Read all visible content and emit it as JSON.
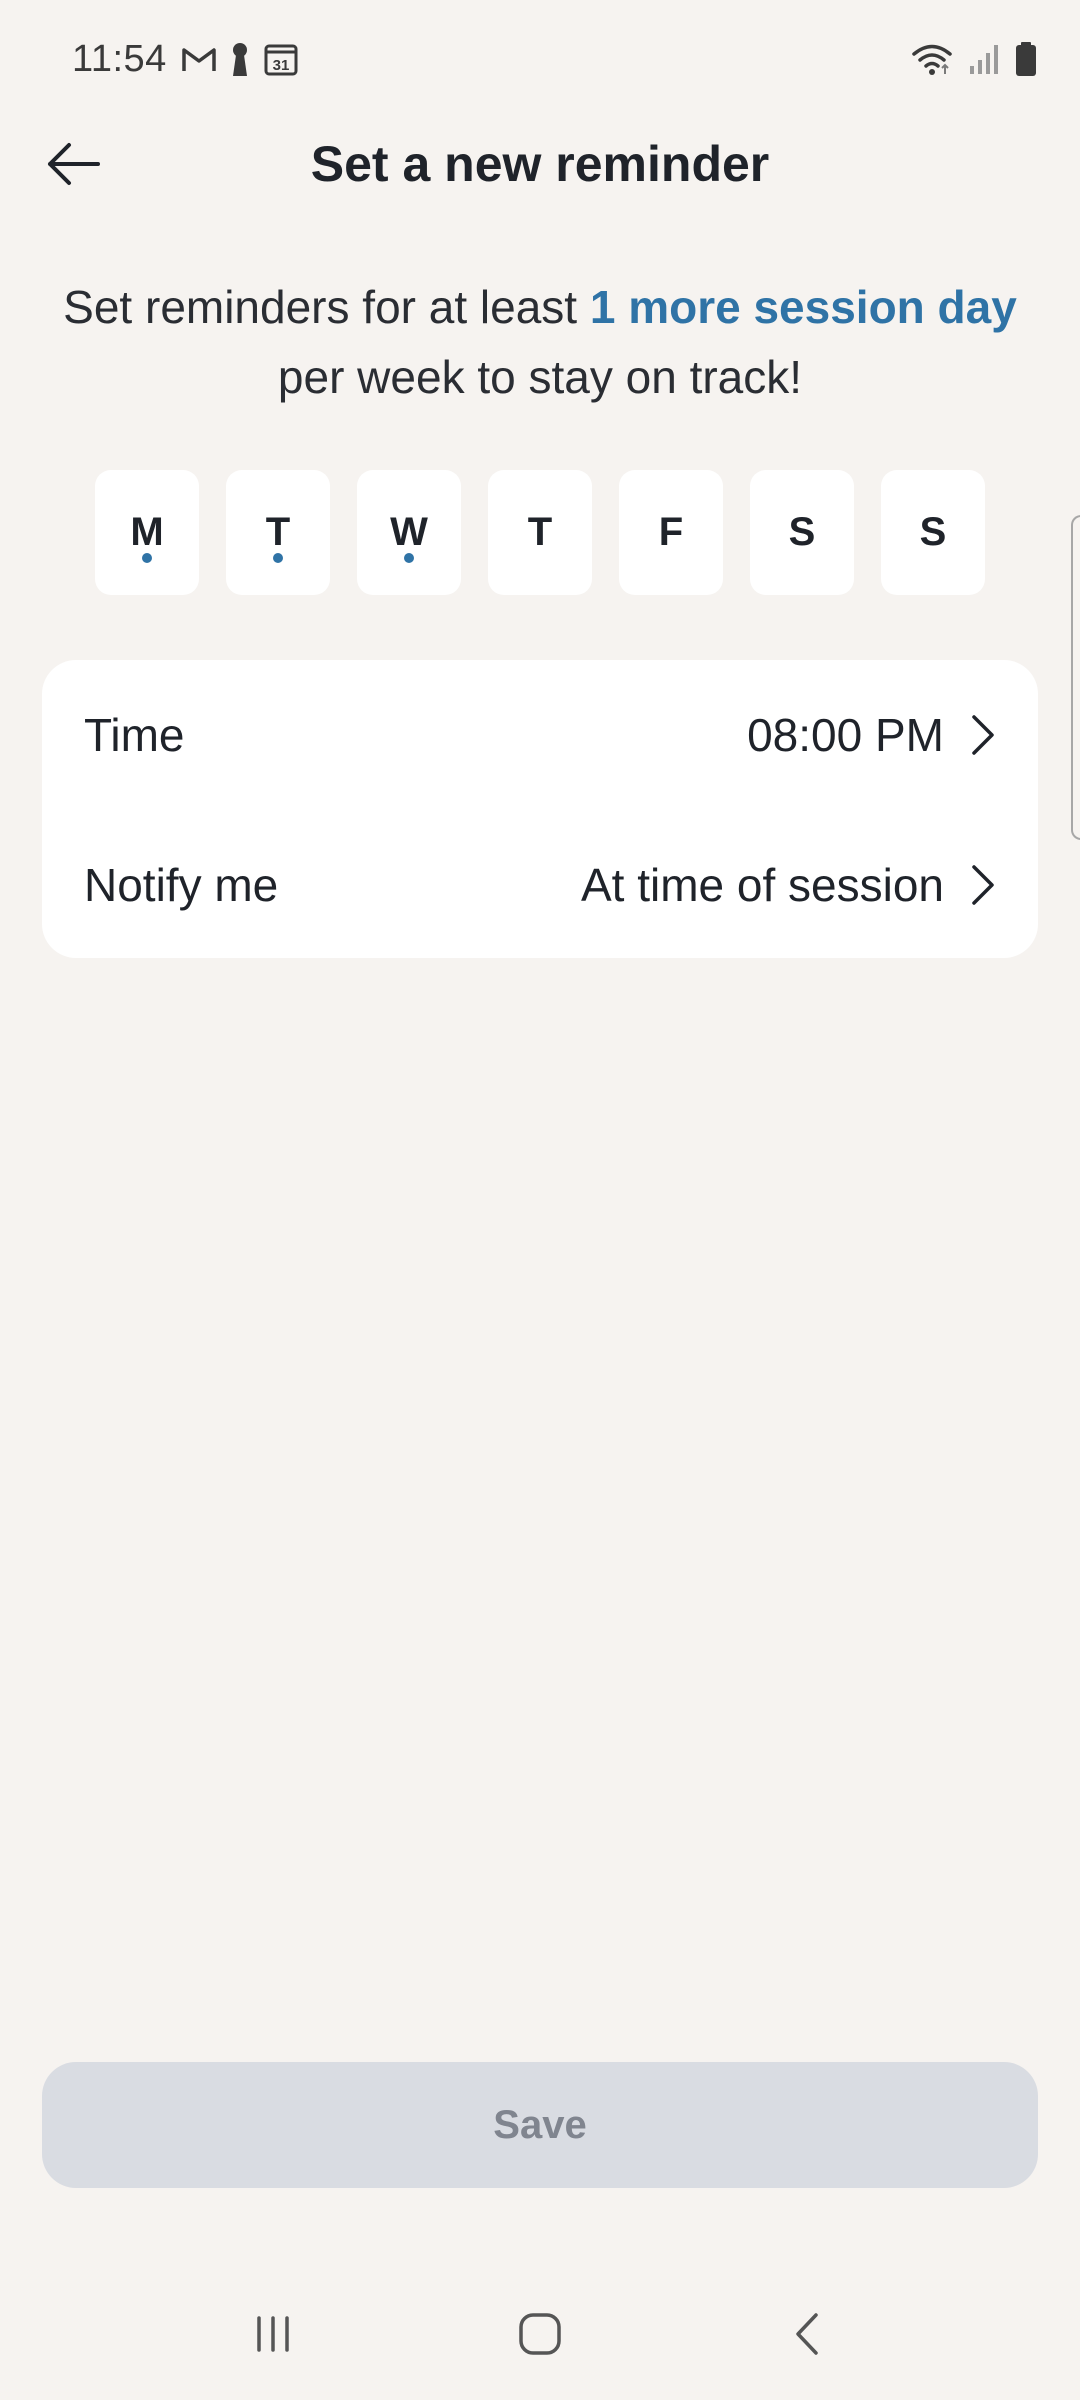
{
  "status_bar": {
    "time": "11:54",
    "left_icons": [
      "gmail-icon",
      "keyhole-icon",
      "calendar-icon"
    ],
    "calendar_day": "31",
    "right_icons": [
      "wifi-icon",
      "signal-icon",
      "battery-icon"
    ]
  },
  "header": {
    "title": "Set a new reminder",
    "back_icon": "arrow-left-icon"
  },
  "intro": {
    "prefix": "Set reminders for at least ",
    "highlight": "1 more session day",
    "suffix": " per week to stay on track!",
    "highlight_color": "#2f73a6"
  },
  "days": [
    {
      "label": "M",
      "has_session": true
    },
    {
      "label": "T",
      "has_session": true
    },
    {
      "label": "W",
      "has_session": true
    },
    {
      "label": "T",
      "has_session": false
    },
    {
      "label": "F",
      "has_session": false
    },
    {
      "label": "S",
      "has_session": false
    },
    {
      "label": "S",
      "has_session": false
    }
  ],
  "settings": {
    "time": {
      "label": "Time",
      "value": "08:00 PM"
    },
    "notify": {
      "label": "Notify me",
      "value": "At time of session"
    }
  },
  "save_label": "Save",
  "nav": {
    "recents": "recents-icon",
    "home": "home-icon",
    "back": "back-icon"
  },
  "colors": {
    "background": "#f6f3f0",
    "card": "#ffffff",
    "accent": "#2f73a6",
    "save_disabled_bg": "#d9dce2",
    "save_disabled_text": "#80858f"
  }
}
